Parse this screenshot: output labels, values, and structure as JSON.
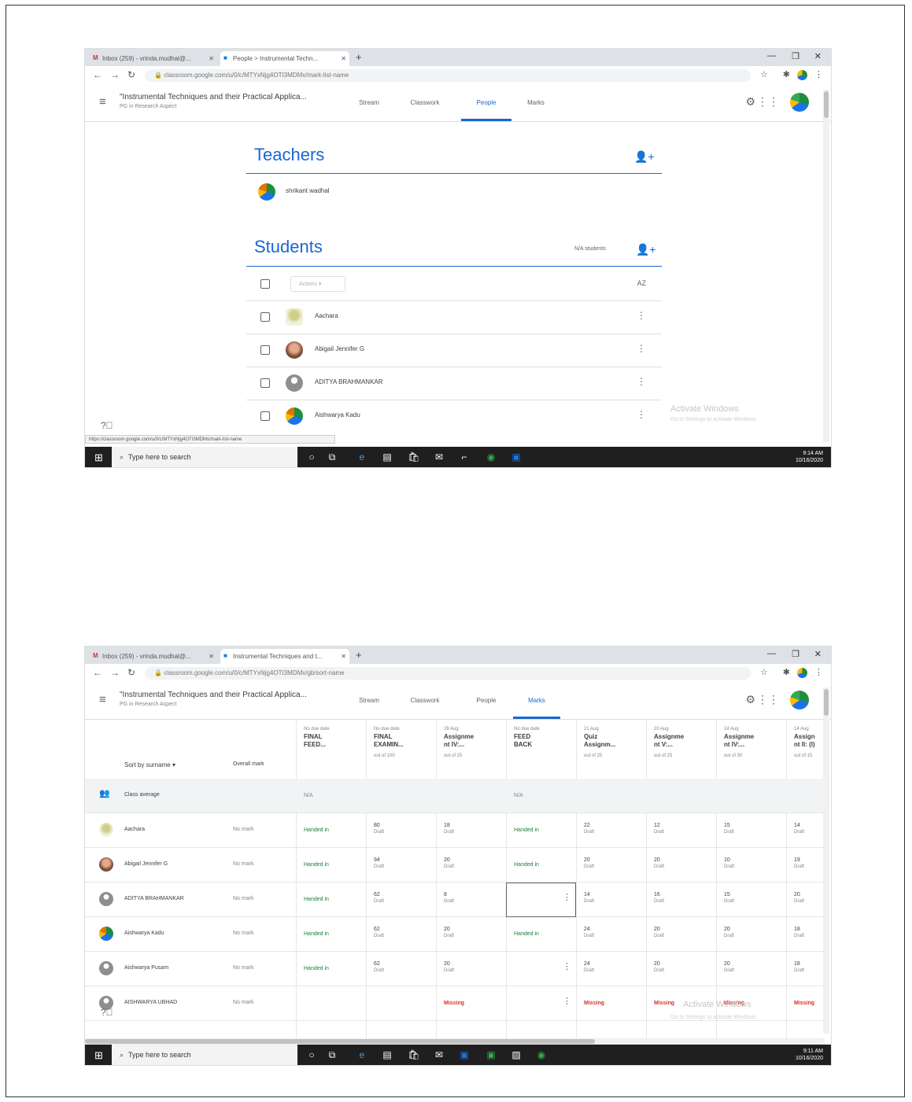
{
  "shot1": {
    "browser": {
      "tab1": {
        "icon": "M",
        "title": "Inbox (259) - vrinda.mudhal@..."
      },
      "tab2": {
        "icon": "■",
        "title": "People > Instrumental Techn..."
      },
      "url": "classroom.google.com/u/0/c/MTYxNjg4OTI3MDMx/mark-list-name"
    },
    "classroom": {
      "title": "\"Instrumental Techniques and their Practical Applica...",
      "subtitle": "PG in Research Aspect",
      "tabs": [
        "Stream",
        "Classwork",
        "People",
        "Marks"
      ],
      "active_tab": "People"
    },
    "teachers": {
      "heading": "Teachers",
      "list": [
        "shrikant wadhal"
      ]
    },
    "students": {
      "heading": "Students",
      "count": "N/A students",
      "actions": "Actions",
      "sort_icon": "AZ",
      "list": [
        "Aachara",
        "Abigail Jennifer G",
        "ADITYA BRAHMANKAR",
        "Aishwarya Kadu"
      ]
    },
    "watermark": {
      "line1": "Activate Windows",
      "line2": "Go to Settings to activate Windows."
    },
    "status_url": "https://classroom.google.com/u/0/c/MTYxNjg4OTI3MDMx/mark-list-name",
    "taskbar": {
      "search": "Type here to search",
      "time": "9:14 AM",
      "date": "10/16/2020"
    }
  },
  "shot2": {
    "browser": {
      "tab1": {
        "icon": "M",
        "title": "Inbox (259) - vrinda.mudhal@..."
      },
      "tab2": {
        "icon": "■",
        "title": "Instrumental Techniques and t..."
      },
      "url": "classroom.google.com/u/0/c/MTYxNjg4OTI3MDMx/gb/sort-name"
    },
    "classroom": {
      "title": "\"Instrumental Techniques and their Practical Applica...",
      "subtitle": "PG in Research Aspect",
      "tabs": [
        "Stream",
        "Classwork",
        "People",
        "Marks"
      ],
      "active_tab": "Marks"
    },
    "sort_label": "Sort by surname",
    "overall_label": "Overall mark",
    "columns": [
      {
        "date": "No due date",
        "title1": "FINAL",
        "title2": "FEED...",
        "out": ""
      },
      {
        "date": "No due date",
        "title1": "FINAL",
        "title2": "EXAMIN...",
        "out": "out of 100"
      },
      {
        "date": "28 Aug",
        "title1": "Assignme",
        "title2": "nt IV:...",
        "out": "out of 25"
      },
      {
        "date": "No due date",
        "title1": "FEED",
        "title2": "BACK",
        "out": ""
      },
      {
        "date": "21 Aug",
        "title1": "Quiz",
        "title2": "Assignm...",
        "out": "out of 25"
      },
      {
        "date": "20 Aug",
        "title1": "Assignme",
        "title2": "nt V:...",
        "out": "out of 25"
      },
      {
        "date": "14 Aug",
        "title1": "Assignme",
        "title2": "nt IV:...",
        "out": "out of 30"
      },
      {
        "date": "14 Aug",
        "title1": "Assign",
        "title2": "nt II: (I)",
        "out": "out of 15"
      }
    ],
    "class_average": {
      "label": "Class average",
      "cells": [
        "N/A",
        "",
        "",
        "N/A",
        "",
        "",
        "",
        ""
      ]
    },
    "students": [
      {
        "name": "Aachara",
        "overall": "No mark",
        "cells": [
          [
            "Handed in",
            ""
          ],
          [
            "80",
            "Draft"
          ],
          [
            "18",
            "Draft"
          ],
          [
            "Handed in",
            ""
          ],
          [
            "22",
            "Draft"
          ],
          [
            "12",
            "Draft"
          ],
          [
            "15",
            "Draft"
          ],
          [
            "14",
            "Draft"
          ]
        ]
      },
      {
        "name": "Abigail Jennifer G",
        "overall": "No mark",
        "cells": [
          [
            "Handed in",
            ""
          ],
          [
            "94",
            "Draft"
          ],
          [
            "20",
            "Draft"
          ],
          [
            "Handed in",
            ""
          ],
          [
            "20",
            "Draft"
          ],
          [
            "20",
            "Draft"
          ],
          [
            "10",
            "Draft"
          ],
          [
            "19",
            "Draft"
          ]
        ]
      },
      {
        "name": "ADITYA BRAHMANKAR",
        "overall": "No mark",
        "cells": [
          [
            "Handed in",
            ""
          ],
          [
            "62",
            "Draft"
          ],
          [
            "8",
            "Draft"
          ],
          [
            "",
            ""
          ],
          [
            "14",
            "Draft"
          ],
          [
            "16",
            "Draft"
          ],
          [
            "15",
            "Draft"
          ],
          [
            "20",
            "Draft"
          ]
        ]
      },
      {
        "name": "Aishwarya Kadu",
        "overall": "No mark",
        "cells": [
          [
            "Handed in",
            ""
          ],
          [
            "62",
            "Draft"
          ],
          [
            "20",
            "Draft"
          ],
          [
            "Handed in",
            ""
          ],
          [
            "24",
            "Draft"
          ],
          [
            "20",
            "Draft"
          ],
          [
            "20",
            "Draft"
          ],
          [
            "18",
            "Draft"
          ]
        ]
      },
      {
        "name": "Aishwarya Pusam",
        "overall": "No mark",
        "cells": [
          [
            "Handed in",
            ""
          ],
          [
            "62",
            "Draft"
          ],
          [
            "20",
            "Draft"
          ],
          [
            "",
            ""
          ],
          [
            "24",
            "Draft"
          ],
          [
            "20",
            "Draft"
          ],
          [
            "20",
            "Draft"
          ],
          [
            "18",
            "Draft"
          ]
        ]
      },
      {
        "name": "AISHWARYA UBHAD",
        "overall": "No mark",
        "cells": [
          [
            "",
            ""
          ],
          [
            "",
            ""
          ],
          [
            "Missing",
            ""
          ],
          [
            "",
            ""
          ],
          [
            "Missing",
            ""
          ],
          [
            "Missing",
            ""
          ],
          [
            "Missing",
            ""
          ],
          [
            "Missing",
            ""
          ]
        ]
      }
    ],
    "watermark": {
      "line1": "Activate Windows",
      "line2": "Go to Settings to activate Windows."
    },
    "taskbar": {
      "search": "Type here to search",
      "time": "9:11 AM",
      "date": "10/16/2020"
    }
  },
  "colors": {
    "accent": "#1967d2",
    "handed_in": "#188038",
    "missing": "#d93025"
  }
}
